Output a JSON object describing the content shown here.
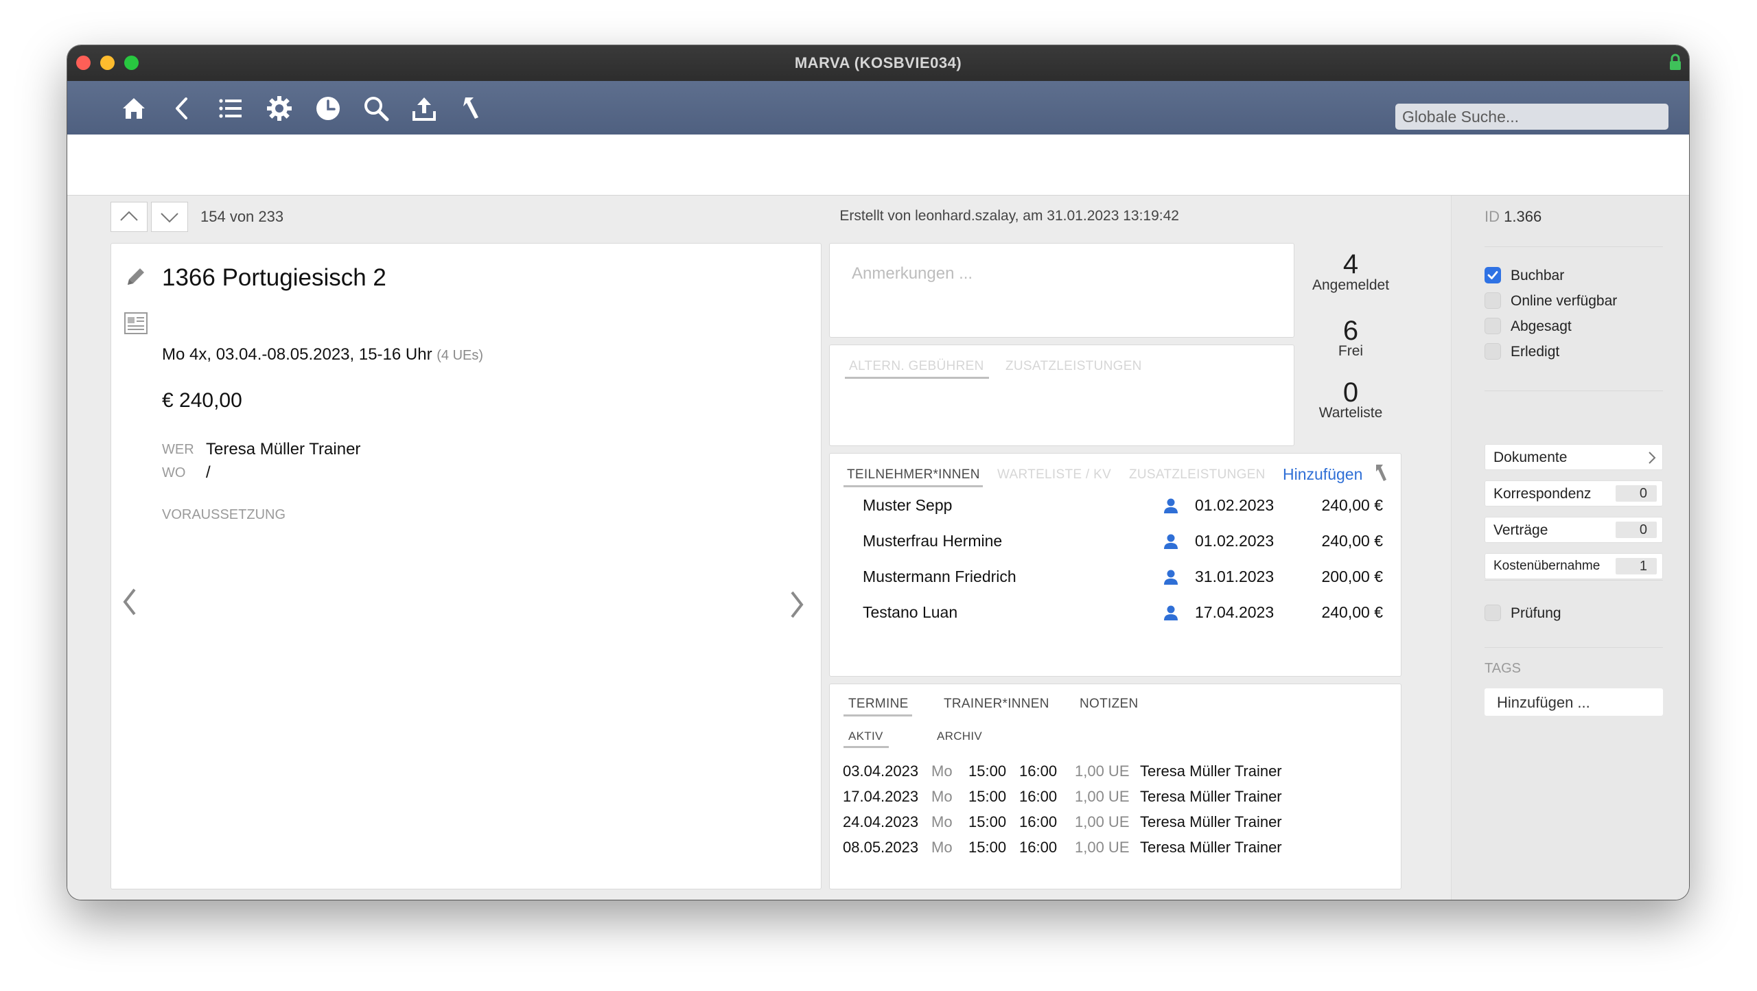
{
  "window": {
    "title": "MARVA (KOSBVIE034)"
  },
  "toolbar": {
    "icons": [
      "home-icon",
      "back-icon",
      "list-icon",
      "gear-icon",
      "clock-icon",
      "search-icon",
      "upload-icon",
      "return-icon"
    ],
    "search_placeholder": "Globale Suche..."
  },
  "record_nav": {
    "position": "154 von 233"
  },
  "meta": {
    "created": "Erstellt von leonhard.szalay, am 31.01.2023 13:19:42"
  },
  "course": {
    "title": "1366 Portugiesisch 2",
    "schedule": "Mo 4x, 03.04.-08.05.2023, 15-16 Uhr",
    "ues": "(4 UEs)",
    "price": "€ 240,00",
    "wer_label": "WER",
    "wer_value": "Teresa Müller Trainer",
    "wo_label": "WO",
    "wo_value": "/",
    "voraussetzung_label": "VORAUSSETZUNG"
  },
  "remarks": {
    "placeholder": "Anmerkungen ..."
  },
  "stats": [
    {
      "value": "4",
      "label": "Angemeldet"
    },
    {
      "value": "6",
      "label": "Frei"
    },
    {
      "value": "0",
      "label": "Warteliste"
    }
  ],
  "fees_tabs": [
    "ALTERN. GEBÜHREN",
    "ZUSATZLEISTUNGEN"
  ],
  "participants": {
    "tabs": [
      "TEILNEHMER*INNEN",
      "WARTELISTE / KV",
      "ZUSATZLEISTUNGEN"
    ],
    "add_label": "Hinzufügen",
    "rows": [
      {
        "name": "Muster Sepp",
        "date": "01.02.2023",
        "amount": "240,00 €"
      },
      {
        "name": "Musterfrau Hermine",
        "date": "01.02.2023",
        "amount": "240,00 €"
      },
      {
        "name": "Mustermann Friedrich",
        "date": "31.01.2023",
        "amount": "200,00 €"
      },
      {
        "name": "Testano Luan",
        "date": "17.04.2023",
        "amount": "240,00 €"
      }
    ]
  },
  "schedule": {
    "tabs": [
      "TERMINE",
      "TRAINER*INNEN",
      "NOTIZEN"
    ],
    "subtabs": [
      "AKTIV",
      "ARCHIV"
    ],
    "rows": [
      {
        "date": "03.04.2023",
        "day": "Mo",
        "start": "15:00",
        "end": "16:00",
        "ue": "1,00 UE",
        "trainer": "Teresa Müller Trainer"
      },
      {
        "date": "17.04.2023",
        "day": "Mo",
        "start": "15:00",
        "end": "16:00",
        "ue": "1,00 UE",
        "trainer": "Teresa Müller Trainer"
      },
      {
        "date": "24.04.2023",
        "day": "Mo",
        "start": "15:00",
        "end": "16:00",
        "ue": "1,00 UE",
        "trainer": "Teresa Müller Trainer"
      },
      {
        "date": "08.05.2023",
        "day": "Mo",
        "start": "15:00",
        "end": "16:00",
        "ue": "1,00 UE",
        "trainer": "Teresa Müller Trainer"
      }
    ]
  },
  "sidebar": {
    "id_label": "ID",
    "id_value": "1.366",
    "checkboxes": [
      {
        "label": "Buchbar",
        "checked": true
      },
      {
        "label": "Online verfügbar",
        "checked": false
      },
      {
        "label": "Abgesagt",
        "checked": false
      },
      {
        "label": "Erledigt",
        "checked": false
      }
    ],
    "links": [
      {
        "label": "Dokumente",
        "count": ""
      },
      {
        "label": "Korrespondenz",
        "count": "0"
      },
      {
        "label": "Verträge",
        "count": "0"
      },
      {
        "label": "Kostenübernahme",
        "count": "1"
      }
    ],
    "pruefung": {
      "label": "Prüfung",
      "checked": false
    },
    "tags_label": "TAGS",
    "tags_add": "Hinzufügen ..."
  },
  "colors": {
    "toolbar": "#56678a",
    "accent_blue": "#2f6fd6",
    "checkbox_on": "#2f72e4"
  }
}
